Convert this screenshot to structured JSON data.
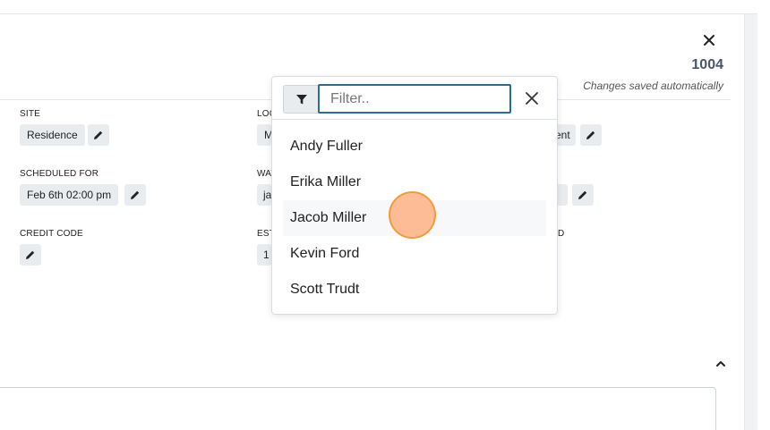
{
  "header": {
    "record_number": "1004",
    "saved_note": "Changes saved automatically"
  },
  "fields": {
    "site": {
      "label": "SITE",
      "value": "Residence"
    },
    "location": {
      "label": "LOC",
      "value": "M"
    },
    "col3_row1": {
      "value": "ent"
    },
    "scheduled_for": {
      "label": "SCHEDULED FOR",
      "value": "Feb 6th 02:00 pm"
    },
    "watch": {
      "label": "WAT",
      "value": "ja"
    },
    "credit_code": {
      "label": "CREDIT CODE"
    },
    "estimate": {
      "label": "EST",
      "value": "1"
    },
    "col3_row3": {
      "label": "D"
    }
  },
  "dropdown": {
    "filter_placeholder": "Filter..",
    "filter_value": "",
    "items": [
      "Andy Fuller",
      "Erika Miller",
      "Jacob Miller",
      "Kevin Ford",
      "Scott Trudt"
    ],
    "hovered_item": "Jacob Miller"
  },
  "icons": {
    "close": "close-icon",
    "edit": "pencil-icon",
    "filter": "filter-icon",
    "chevron": "chevron-up-icon"
  },
  "colors": {
    "focus_border": "#2f6c8f",
    "chip_bg": "#e9ecef",
    "cursor_fill": "#ffa56e"
  }
}
